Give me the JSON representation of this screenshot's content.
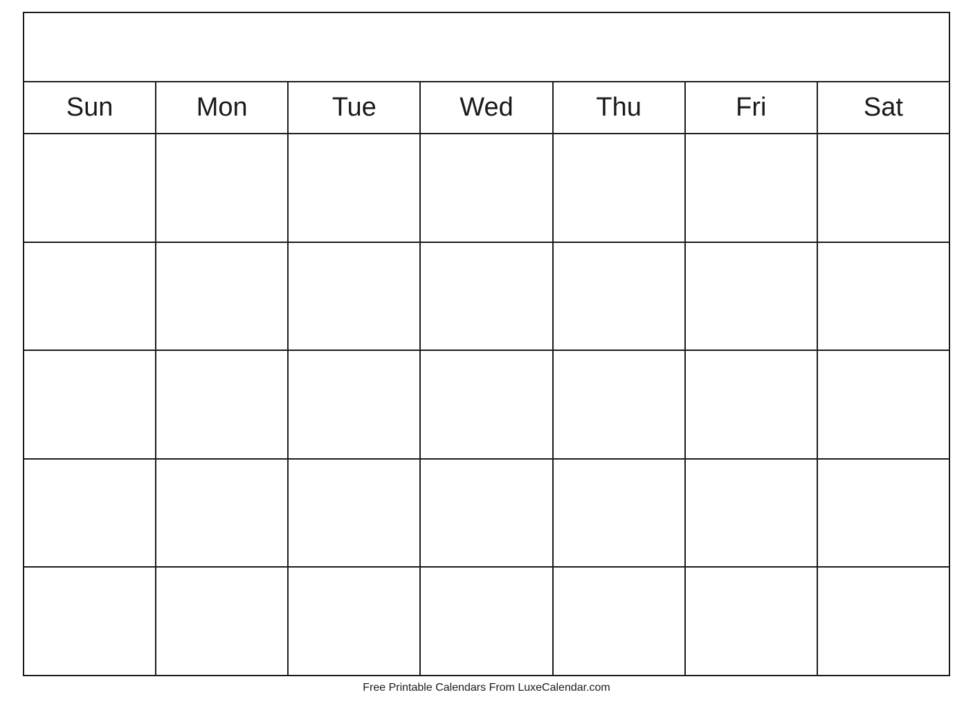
{
  "calendar": {
    "title": "",
    "days": [
      "Sun",
      "Mon",
      "Tue",
      "Wed",
      "Thu",
      "Fri",
      "Sat"
    ],
    "weeks": 5
  },
  "footer": {
    "text": "Free Printable Calendars From LuxeCalendar.com"
  }
}
